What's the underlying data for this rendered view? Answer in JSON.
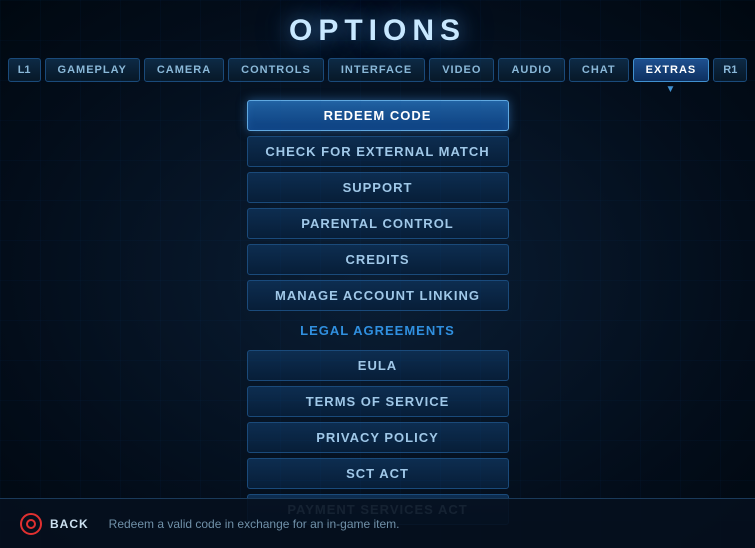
{
  "page": {
    "title": "OPTIONS"
  },
  "tabs": {
    "items": [
      {
        "label": "L1",
        "id": "l1",
        "side": true,
        "active": false
      },
      {
        "label": "GAMEPLAY",
        "id": "gameplay",
        "active": false
      },
      {
        "label": "CAMERA",
        "id": "camera",
        "active": false
      },
      {
        "label": "CONTROLS",
        "id": "controls",
        "active": false
      },
      {
        "label": "INTERFACE",
        "id": "interface",
        "active": false
      },
      {
        "label": "VIDEO",
        "id": "video",
        "active": false
      },
      {
        "label": "AUDIO",
        "id": "audio",
        "active": false
      },
      {
        "label": "CHAT",
        "id": "chat",
        "active": false
      },
      {
        "label": "EXTRAS",
        "id": "extras",
        "active": true
      },
      {
        "label": "R1",
        "id": "r1",
        "side": true,
        "active": false
      }
    ]
  },
  "menu": {
    "items": [
      {
        "label": "REDEEM CODE",
        "selected": true,
        "type": "item"
      },
      {
        "label": "CHECK FOR EXTERNAL MATCH",
        "selected": false,
        "type": "item"
      },
      {
        "label": "SUPPORT",
        "selected": false,
        "type": "item"
      },
      {
        "label": "PARENTAL CONTROL",
        "selected": false,
        "type": "item"
      },
      {
        "label": "CREDITS",
        "selected": false,
        "type": "item"
      },
      {
        "label": "MANAGE ACCOUNT LINKING",
        "selected": false,
        "type": "item"
      },
      {
        "label": "LEGAL AGREEMENTS",
        "selected": false,
        "type": "label"
      },
      {
        "label": "EULA",
        "selected": false,
        "type": "item"
      },
      {
        "label": "TERMS OF SERVICE",
        "selected": false,
        "type": "item"
      },
      {
        "label": "PRIVACY POLICY",
        "selected": false,
        "type": "item"
      },
      {
        "label": "SCT ACT",
        "selected": false,
        "type": "item"
      },
      {
        "label": "PAYMENT SERVICES ACT",
        "selected": false,
        "type": "item"
      }
    ]
  },
  "bottom": {
    "back_label": "BACK",
    "hint_text": "Redeem a valid code in exchange for an in-game item."
  }
}
